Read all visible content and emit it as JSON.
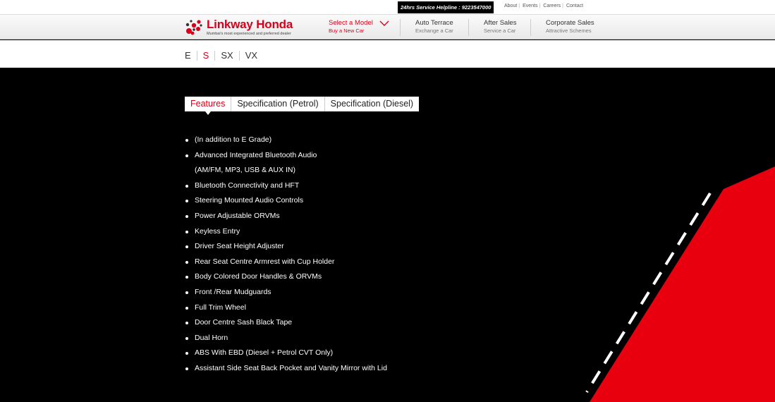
{
  "topbar": {
    "helpline": "24hrs Service Helpline : 9223547000",
    "links": [
      "About",
      "Events",
      "Careers",
      "Contact"
    ]
  },
  "brand": {
    "name": "Linkway Honda",
    "tagline": "Mumbai's most experienced and preferred dealer",
    "icon": "honda-dots-logo-icon"
  },
  "nav": {
    "items": [
      {
        "main": "Select a Model",
        "sub": "Buy a New Car"
      },
      {
        "main": "Auto Terrace",
        "sub": "Exchange a Car"
      },
      {
        "main": "After Sales",
        "sub": "Service a Car"
      },
      {
        "main": "Corporate Sales",
        "sub": "Attractive Schemes"
      }
    ],
    "dropdown_icon": "chevron-down-icon"
  },
  "grades": {
    "items": [
      "E",
      "S",
      "SX",
      "VX"
    ],
    "active": "S"
  },
  "tabs": {
    "items": [
      "Features",
      "Specification (Petrol)",
      "Specification (Diesel)"
    ],
    "active": "Features"
  },
  "features": [
    "(In addition to E Grade)",
    "Advanced Integrated Bluetooth Audio",
    "(AM/FM, MP3, USB & AUX IN)",
    "Bluetooth Connectivity and HFT",
    "Steering Mounted Audio Controls",
    "Power Adjustable ORVMs",
    "Keyless Entry",
    "Driver Seat Height Adjuster",
    "Rear Seat Centre Armrest with Cup Holder",
    "Body Colored Door Handles & ORVMs",
    "Front /Rear Mudguards",
    "Full Trim Wheel",
    "Door Centre Sash Black Tape",
    "Dual Horn",
    "ABS With EBD (Diesel + Petrol CVT Only)",
    "Assistant Side Seat Back Pocket and Vanity Mirror with Lid"
  ],
  "colors": {
    "accent": "#d8001c",
    "background": "#000000",
    "road_red": "#e8000f"
  }
}
